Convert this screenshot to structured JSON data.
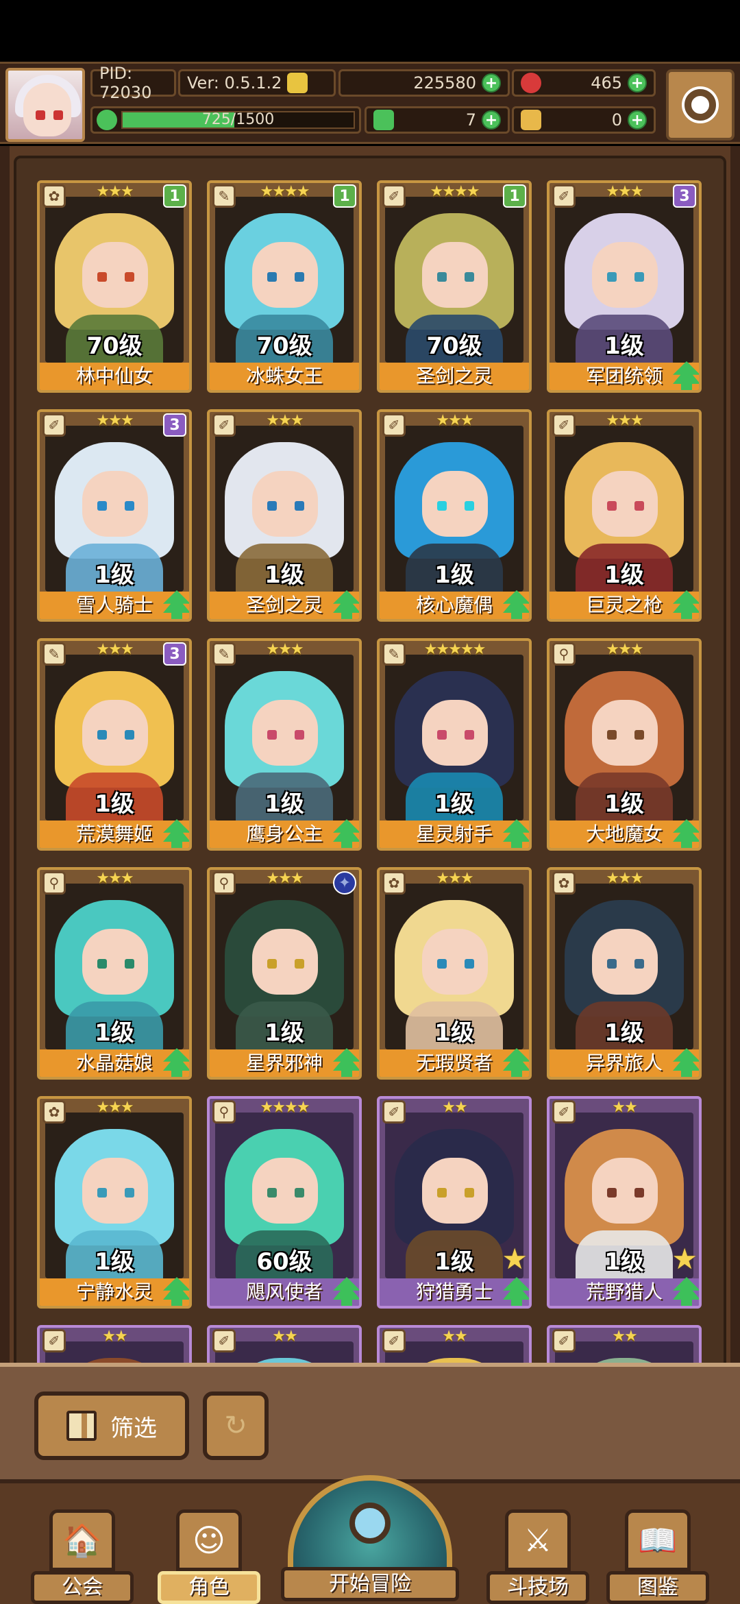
{
  "hud": {
    "pid": "PID: 72030",
    "version": "Ver: 0.5.1.2",
    "gold": "225580",
    "gems": "465",
    "exp": "725/1500",
    "exp_fraction": 0.483,
    "clover": "7",
    "keys": "0"
  },
  "cards": [
    {
      "stars": "★★★",
      "level": "70级",
      "name": "林中仙女",
      "badge": "1",
      "badge_type": "green",
      "icon": "✿",
      "frame": "gold",
      "hair": "#e8c56a",
      "body": "#5a7a3a",
      "eye": "#c94a2a",
      "up": false,
      "star": false
    },
    {
      "stars": "★★★★",
      "level": "70级",
      "name": "冰蛛女王",
      "badge": "1",
      "badge_type": "green",
      "icon": "✎",
      "frame": "gold",
      "hair": "#6ad0e0",
      "body": "#3a8aa0",
      "eye": "#2a7ab0",
      "up": false,
      "star": false
    },
    {
      "stars": "★★★★",
      "level": "70级",
      "name": "圣剑之灵",
      "badge": "1",
      "badge_type": "green",
      "icon": "✐",
      "frame": "gold",
      "hair": "#b8b05a",
      "body": "#2a4a6a",
      "eye": "#3a8a9a",
      "up": false,
      "star": false
    },
    {
      "stars": "★★★",
      "level": "1级",
      "name": "军团统领",
      "badge": "3",
      "badge_type": "purple",
      "icon": "✐",
      "frame": "gold",
      "hair": "#d8d0e8",
      "body": "#5a4a7a",
      "eye": "#3a9ab8",
      "up": true,
      "star": false
    },
    {
      "stars": "★★★",
      "level": "1级",
      "name": "雪人骑士",
      "badge": "3",
      "badge_type": "purple",
      "icon": "✐",
      "frame": "gold",
      "hair": "#dce8f2",
      "body": "#6ab0d8",
      "eye": "#2a8ac8",
      "up": true,
      "star": false
    },
    {
      "stars": "★★★",
      "level": "1级",
      "name": "圣剑之灵",
      "badge": "",
      "badge_type": "",
      "icon": "✐",
      "frame": "gold",
      "hair": "#e2e6ee",
      "body": "#8a6a3a",
      "eye": "#2a7ab8",
      "up": true,
      "star": false
    },
    {
      "stars": "★★★",
      "level": "1级",
      "name": "核心魔偶",
      "badge": "",
      "badge_type": "",
      "icon": "✐",
      "frame": "gold",
      "hair": "#2a9ad8",
      "body": "#2a3a4a",
      "eye": "#2ad0e0",
      "up": true,
      "star": false
    },
    {
      "stars": "★★★",
      "level": "1级",
      "name": "巨灵之枪",
      "badge": "",
      "badge_type": "",
      "icon": "✐",
      "frame": "gold",
      "hair": "#e8b85a",
      "body": "#8a2a2a",
      "eye": "#c94a5a",
      "up": true,
      "star": false
    },
    {
      "stars": "★★★",
      "level": "1级",
      "name": "荒漠舞姬",
      "badge": "3",
      "badge_type": "purple",
      "icon": "✎",
      "frame": "gold",
      "hair": "#f0c050",
      "body": "#c84a2a",
      "eye": "#2a8ab8",
      "up": true,
      "star": false
    },
    {
      "stars": "★★★",
      "level": "1级",
      "name": "鹰身公主",
      "badge": "",
      "badge_type": "",
      "icon": "✎",
      "frame": "gold",
      "hair": "#6ad8d8",
      "body": "#4a6a7a",
      "eye": "#c94a6a",
      "up": true,
      "star": false
    },
    {
      "stars": "★★★★★",
      "level": "1级",
      "name": "星灵射手",
      "badge": "",
      "badge_type": "",
      "icon": "✎",
      "frame": "gold",
      "hair": "#2a3050",
      "body": "#1a8ab0",
      "eye": "#c94a6a",
      "up": true,
      "star": false
    },
    {
      "stars": "★★★",
      "level": "1级",
      "name": "大地魔女",
      "badge": "",
      "badge_type": "",
      "icon": "⚲",
      "frame": "gold",
      "hair": "#c06a3a",
      "body": "#7a3a2a",
      "eye": "#7a4a2a",
      "up": true,
      "star": false
    },
    {
      "stars": "★★★",
      "level": "1级",
      "name": "水晶菇娘",
      "badge": "",
      "badge_type": "",
      "icon": "⚲",
      "frame": "gold",
      "hair": "#4ac8c0",
      "body": "#3a9aa8",
      "eye": "#2a8a6a",
      "up": true,
      "star": false
    },
    {
      "stars": "★★★",
      "level": "1级",
      "name": "星界邪神",
      "badge": "✦",
      "badge_type": "gem",
      "icon": "⚲",
      "frame": "gold",
      "hair": "#2a4a3a",
      "body": "#3a5a4a",
      "eye": "#c9a02a",
      "up": true,
      "star": false
    },
    {
      "stars": "★★★",
      "level": "1级",
      "name": "无瑕贤者",
      "badge": "",
      "badge_type": "",
      "icon": "✿",
      "frame": "gold",
      "hair": "#f0d890",
      "body": "#e0c0a0",
      "eye": "#2a8ab8",
      "up": true,
      "star": false
    },
    {
      "stars": "★★★",
      "level": "1级",
      "name": "异界旅人",
      "badge": "",
      "badge_type": "",
      "icon": "✿",
      "frame": "gold",
      "hair": "#2a3a4a",
      "body": "#6a3a2a",
      "eye": "#3a6a8a",
      "up": true,
      "star": false
    },
    {
      "stars": "★★★",
      "level": "1级",
      "name": "宁静水灵",
      "badge": "",
      "badge_type": "",
      "icon": "✿",
      "frame": "gold",
      "hair": "#7ad8e8",
      "body": "#5ab8d0",
      "eye": "#3a9ab8",
      "up": true,
      "star": false
    },
    {
      "stars": "★★★★",
      "level": "60级",
      "name": "飓风使者",
      "badge": "",
      "badge_type": "",
      "icon": "⚲",
      "frame": "purple",
      "hair": "#4ad0b0",
      "body": "#2a6a5a",
      "eye": "#3a8a6a",
      "up": true,
      "star": false
    },
    {
      "stars": "★★",
      "level": "1级",
      "name": "狩猎勇士",
      "badge": "",
      "badge_type": "",
      "icon": "✐",
      "frame": "purple",
      "hair": "#2a2a4a",
      "body": "#6a4a2a",
      "eye": "#c9a02a",
      "up": true,
      "star": true
    },
    {
      "stars": "★★",
      "level": "1级",
      "name": "荒野猎人",
      "badge": "",
      "badge_type": "",
      "icon": "✐",
      "frame": "purple",
      "hair": "#d08a4a",
      "body": "#e8e8e8",
      "eye": "#7a3a2a",
      "up": true,
      "star": true
    },
    {
      "stars": "★★",
      "level": "",
      "name": "",
      "badge": "",
      "badge_type": "",
      "icon": "✐",
      "frame": "purple",
      "hair": "#8a4a2a",
      "body": "#5a3a2a",
      "eye": "#000",
      "up": false,
      "star": false
    },
    {
      "stars": "★★",
      "level": "",
      "name": "",
      "badge": "",
      "badge_type": "",
      "icon": "✐",
      "frame": "purple",
      "hair": "#6ac8d8",
      "body": "#4a8aa0",
      "eye": "#000",
      "up": false,
      "star": false
    },
    {
      "stars": "★★",
      "level": "",
      "name": "",
      "badge": "",
      "badge_type": "",
      "icon": "✐",
      "frame": "purple",
      "hair": "#e8c050",
      "body": "#c08a3a",
      "eye": "#000",
      "up": false,
      "star": false
    },
    {
      "stars": "★★",
      "level": "",
      "name": "",
      "badge": "",
      "badge_type": "",
      "icon": "✐",
      "frame": "purple",
      "hair": "#8ab090",
      "body": "#5a7a5a",
      "eye": "#000",
      "up": false,
      "star": false
    }
  ],
  "filter": {
    "label": "筛选"
  },
  "nav": {
    "guild": "公会",
    "character": "角色",
    "adventure": "开始冒险",
    "arena": "斗技场",
    "codex": "图鉴"
  }
}
